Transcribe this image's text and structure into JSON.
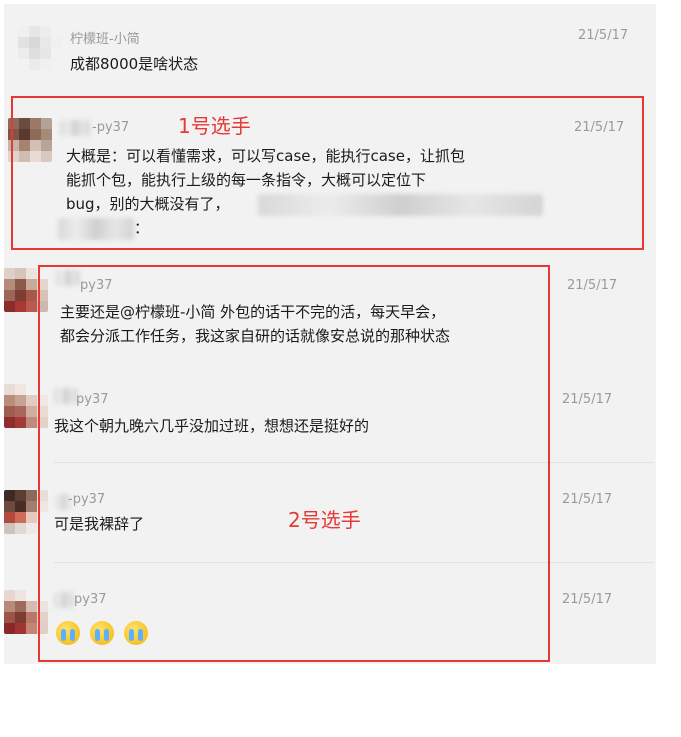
{
  "messages": [
    {
      "sender": "柠檬班-小简",
      "time": "21/5/17",
      "text": "成都8000是啥状态"
    },
    {
      "sender": "-py37",
      "time": "21/5/17",
      "lines": [
        "大概是：可以看懂需求，可以写case，能执行case，让抓包",
        "能抓个包，能执行上级的每一条指令，大概可以定位下",
        "bug，别的大概没有了，"
      ],
      "trailing": "："
    },
    {
      "sender": "py37",
      "time": "21/5/17",
      "lines": [
        "主要还是@柠檬班-小简 外包的话干不完的活，每天早会，",
        "都会分派工作任务，我这家自研的话就像安总说的那种状态"
      ]
    },
    {
      "sender": "py37",
      "time": "21/5/17",
      "text": "我这个朝九晚六几乎没加过班，想想还是挺好的"
    },
    {
      "sender": "-py37",
      "time": "21/5/17",
      "text": "可是我裸辞了"
    },
    {
      "sender": "py37",
      "time": "21/5/17",
      "emojis": [
        "crying-face-icon",
        "crying-face-icon",
        "crying-face-icon"
      ]
    }
  ],
  "annotations": {
    "label1": "1号选手",
    "label2": "2号选手",
    "color": "#e53935"
  }
}
